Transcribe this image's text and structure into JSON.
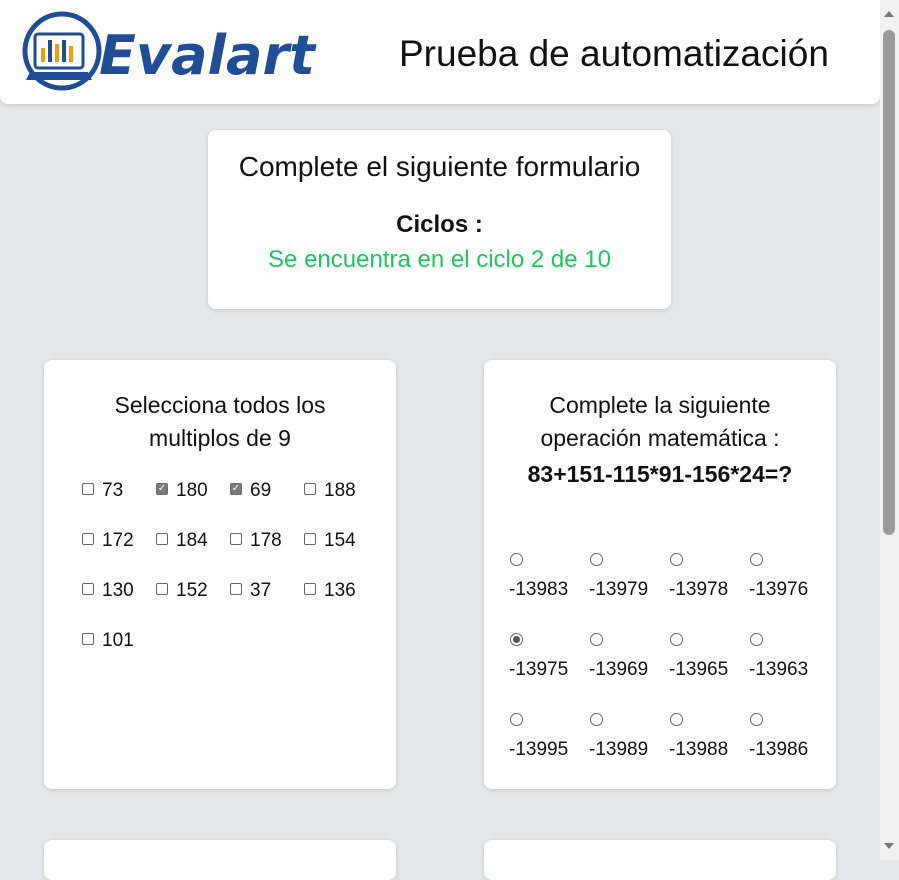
{
  "header": {
    "logo_text": "Evalart",
    "title": "Prueba de automatización"
  },
  "info": {
    "title": "Complete el siguiente formulario",
    "cycles_label": "Ciclos :",
    "cycle_status": "Se encuentra en el ciclo 2 de 10"
  },
  "checkbox_question": {
    "title": "Selecciona todos los multiplos de 9",
    "options": [
      {
        "label": "73",
        "checked": false
      },
      {
        "label": "180",
        "checked": true
      },
      {
        "label": "69",
        "checked": true
      },
      {
        "label": "188",
        "checked": false
      },
      {
        "label": "172",
        "checked": false
      },
      {
        "label": "184",
        "checked": false
      },
      {
        "label": "178",
        "checked": false
      },
      {
        "label": "154",
        "checked": false
      },
      {
        "label": "130",
        "checked": false
      },
      {
        "label": "152",
        "checked": false
      },
      {
        "label": "37",
        "checked": false
      },
      {
        "label": "136",
        "checked": false
      },
      {
        "label": "101",
        "checked": false
      }
    ]
  },
  "math_question": {
    "title": "Complete la siguiente operación matemática :",
    "expression": "83+151-115*91-156*24=?",
    "options": [
      {
        "label": "-13983",
        "checked": false
      },
      {
        "label": "-13979",
        "checked": false
      },
      {
        "label": "-13978",
        "checked": false
      },
      {
        "label": "-13976",
        "checked": false
      },
      {
        "label": "-13975",
        "checked": true
      },
      {
        "label": "-13969",
        "checked": false
      },
      {
        "label": "-13965",
        "checked": false
      },
      {
        "label": "-13963",
        "checked": false
      },
      {
        "label": "-13995",
        "checked": false
      },
      {
        "label": "-13989",
        "checked": false
      },
      {
        "label": "-13988",
        "checked": false
      },
      {
        "label": "-13986",
        "checked": false
      }
    ]
  },
  "colors": {
    "background": "#e5e7eb",
    "cycle_status": "#22c55e",
    "logo_blue": "#1f4e97"
  }
}
